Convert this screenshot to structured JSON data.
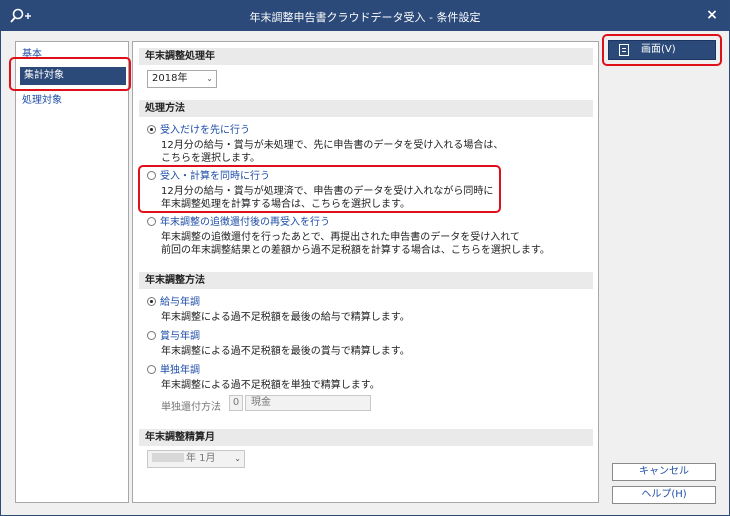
{
  "window": {
    "title": "年末調整申告書クラウドデータ受入 - 条件設定",
    "close": "×"
  },
  "sidebar": {
    "items": [
      {
        "label": "基本"
      },
      {
        "label": "集計対象"
      },
      {
        "label": "処理対象"
      }
    ]
  },
  "sections": {
    "year": {
      "title": "年末調整処理年",
      "value": "2018年"
    },
    "method": {
      "title": "処理方法",
      "options": [
        {
          "label": "受入だけを先に行う",
          "selected": true,
          "desc": [
            "12月分の給与・賞与が未処理で、先に申告書のデータを受け入れる場合は、",
            "こちらを選択します。"
          ]
        },
        {
          "label": "受入・計算を同時に行う",
          "selected": false,
          "desc": [
            "12月分の給与・賞与が処理済で、申告書のデータを受け入れながら同時に",
            "年末調整処理を計算する場合は、こちらを選択します。"
          ]
        },
        {
          "label": "年末調整の追徴還付後の再受入を行う",
          "selected": false,
          "desc": [
            "年末調整の追徴還付を行ったあとで、再提出された申告書のデータを受け入れて",
            "前回の年末調整結果との差額から過不足税額を計算する場合は、こちらを選択します。"
          ]
        }
      ]
    },
    "adjust": {
      "title": "年末調整方法",
      "options": [
        {
          "label": "給与年調",
          "selected": true,
          "desc": "年末調整による過不足税額を最後の給与で精算します。"
        },
        {
          "label": "賞与年調",
          "selected": false,
          "desc": "年末調整による過不足税額を最後の賞与で精算します。"
        },
        {
          "label": "単独年調",
          "selected": false,
          "desc": "年末調整による過不足税額を単独で精算します。"
        }
      ],
      "refund_label": "単独還付方法",
      "refund_code": "0",
      "refund_value": "現金"
    },
    "month": {
      "title": "年末調整精算月",
      "value": "年 1月"
    }
  },
  "buttons": {
    "screen": "画面(V)",
    "cancel": "キャンセル",
    "help": "ヘルプ(H)"
  }
}
